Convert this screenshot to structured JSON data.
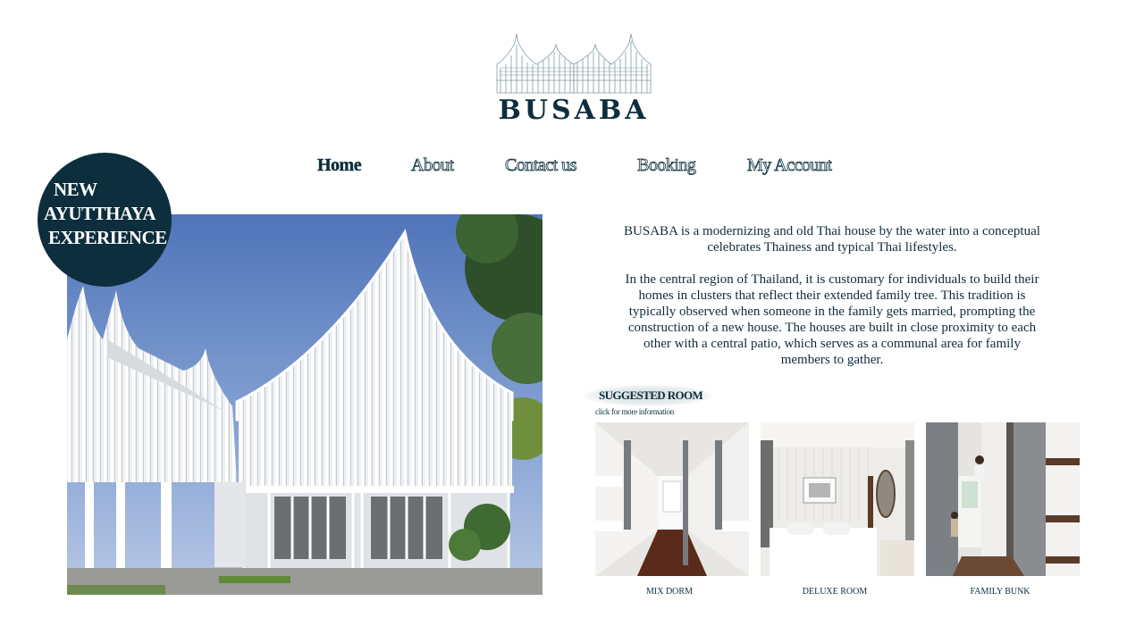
{
  "brand": {
    "name": "BUSABA",
    "logo_icon": "thai-rooftops-logo-icon"
  },
  "nav": [
    {
      "label": "Home",
      "active": true
    },
    {
      "label": "About",
      "active": false
    },
    {
      "label": "Contact us",
      "active": false
    },
    {
      "label": "Booking",
      "active": false
    },
    {
      "label": "My Account",
      "active": false
    }
  ],
  "badge": {
    "lines": [
      "NEW",
      "AYUTTHAYA",
      "EXPERIENCE"
    ]
  },
  "hero": {
    "image": "white-thai-house-photo"
  },
  "description": {
    "p1_lines": [
      "BUSABA is a modernizing and old Thai house by the water into a conceptual",
      "celebrates Thainess and typical Thai lifestyles."
    ],
    "p2_lines": [
      "In the central region of Thailand, it is customary for individuals to build their",
      "homes in clusters that reflect their extended family tree. This tradition is",
      "typically observed when someone in the family gets married, prompting the",
      "construction of a new house. The houses are built in close proximity to each",
      "other with a central patio, which serves as a communal area for family",
      "members to gather."
    ]
  },
  "suggested": {
    "title": "SUGGESTED ROOM",
    "subtitle": "click for more information",
    "rooms": [
      {
        "label": "MIX DORM",
        "image": "mix-dorm-photo"
      },
      {
        "label": "DELUXE ROOM",
        "image": "deluxe-room-photo"
      },
      {
        "label": "FAMILY BUNK",
        "image": "family-bunk-photo"
      }
    ]
  },
  "colors": {
    "primary": "#0d2e3d",
    "background": "#ffffff"
  }
}
